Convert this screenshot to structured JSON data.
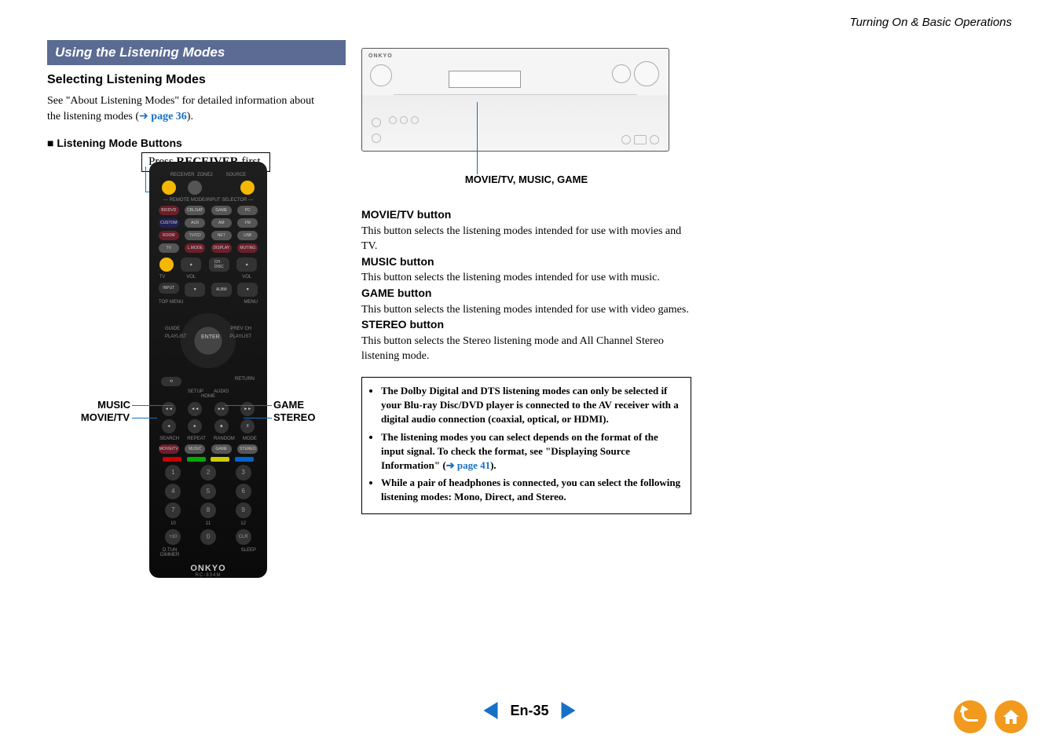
{
  "header": {
    "chapter": "Turning On & Basic Operations"
  },
  "section": {
    "title": "Using the Listening Modes",
    "sub1_title": "Selecting Listening Modes",
    "intro_1": "See \"About Listening Modes\" for detailed information about the listening modes (",
    "intro_link_arrow": "➔ ",
    "intro_link": "page 36",
    "intro_2": ").",
    "sub2_title": "Listening Mode Buttons"
  },
  "remote": {
    "callout_prefix": "Press ",
    "callout_bold": "RECEIVER",
    "callout_suffix": " first.",
    "left_top": "MUSIC",
    "left_bottom": "MOVIE/TV",
    "right_top": "GAME",
    "right_bottom": "STEREO",
    "brand": "ONKYO",
    "model": "RC-834M"
  },
  "receiver": {
    "caption": "MOVIE/TV, MUSIC, GAME",
    "brand": "ONKYO"
  },
  "buttons": {
    "movie_title": "MOVIE/TV",
    "movie_suffix": " button",
    "movie_desc": "This button selects the listening modes intended for use with movies and TV.",
    "music_title": "MUSIC",
    "music_suffix": " button",
    "music_desc": "This button selects the listening modes intended for use with music.",
    "game_title": "GAME",
    "game_suffix": " button",
    "game_desc": "This button selects the listening modes intended for use with video games.",
    "stereo_title": "STEREO",
    "stereo_suffix": " button",
    "stereo_desc": "This button selects the Stereo listening mode and All Channel Stereo listening mode."
  },
  "notes": {
    "n1": "The Dolby Digital and DTS listening modes can only be selected if your Blu-ray Disc/DVD player is connected to the AV receiver with a digital audio connection (coaxial, optical, or HDMI).",
    "n2a": "The listening modes you can select depends on the format of the input signal. To check the format, see \"Displaying Source Information\" (",
    "n2_link_arrow": "➔ ",
    "n2_link": "page 41",
    "n2b": ").",
    "n3": "While a pair of headphones is connected, you can select the following listening modes: Mono, Direct, and Stereo."
  },
  "footer": {
    "page": "En-35"
  }
}
